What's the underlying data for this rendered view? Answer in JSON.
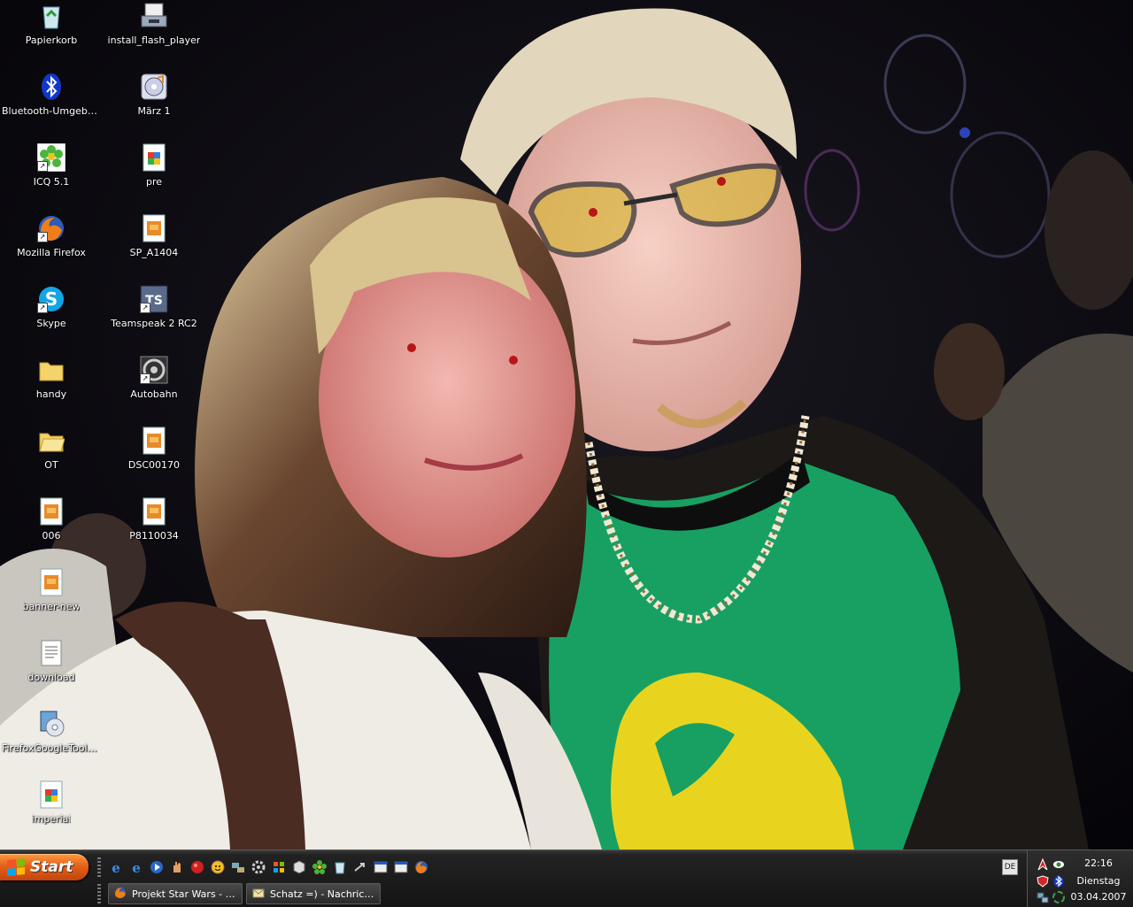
{
  "desktop": {
    "icons": [
      {
        "label": "Papierkorb",
        "icon": "recycle-bin-icon"
      },
      {
        "label": "Bluetooth-Umgebung",
        "icon": "bluetooth-icon"
      },
      {
        "label": "ICQ 5.1",
        "icon": "icq-flower-icon"
      },
      {
        "label": "Mozilla Firefox",
        "icon": "firefox-icon"
      },
      {
        "label": "Skype",
        "icon": "skype-icon"
      },
      {
        "label": "handy",
        "icon": "folder-icon"
      },
      {
        "label": "OT",
        "icon": "folder-open-icon"
      },
      {
        "label": "006",
        "icon": "image-file-icon"
      },
      {
        "label": "banner-new",
        "icon": "image-file-icon"
      },
      {
        "label": "download",
        "icon": "text-document-icon"
      },
      {
        "label": "FirefoxGoogleToolb...",
        "icon": "installer-cd-icon"
      },
      {
        "label": "imperial",
        "icon": "image-document-icon"
      },
      {
        "label": "install_flash_player",
        "icon": "installer-icon"
      },
      {
        "label": "März 1",
        "icon": "audio-file-icon"
      },
      {
        "label": "pre",
        "icon": "image-document-icon"
      },
      {
        "label": "SP_A1404",
        "icon": "image-file-icon"
      },
      {
        "label": "Teamspeak 2 RC2",
        "icon": "teamspeak-icon"
      },
      {
        "label": "Autobahn",
        "icon": "game-wheel-icon"
      },
      {
        "label": "DSC00170",
        "icon": "image-file-icon"
      },
      {
        "label": "P8110034",
        "icon": "image-file-icon"
      }
    ]
  },
  "taskbar": {
    "start_label": "Start",
    "quick_launch": [
      "ie-icon",
      "ie-icon",
      "media-player-icon",
      "hand-icon",
      "red-ball-icon",
      "smiley-icon",
      "network-icon",
      "gear-icon",
      "windows-icon",
      "cube-icon",
      "icq-flower-icon",
      "bin-icon",
      "arrow-icon",
      "window-icon",
      "window-icon",
      "firefox-icon"
    ],
    "windows": [
      {
        "label": "Projekt Star Wars - A...",
        "icon": "firefox-icon"
      },
      {
        "label": "Schatz =) - Nachricht...",
        "icon": "envelope-icon"
      }
    ],
    "language": "DE",
    "tray": {
      "time": "22:16",
      "day": "Dienstag",
      "date": "03.04.2007",
      "icons": [
        "antivirus-icon",
        "eye-icon",
        "shield-icon",
        "bluetooth-icon",
        "network-icon",
        "recycle-icon"
      ]
    }
  },
  "colors": {
    "taskbar": "#1c1c1c",
    "start": "#e5611b",
    "shirt_green": "#18a062",
    "print_yellow": "#e8d41e"
  }
}
